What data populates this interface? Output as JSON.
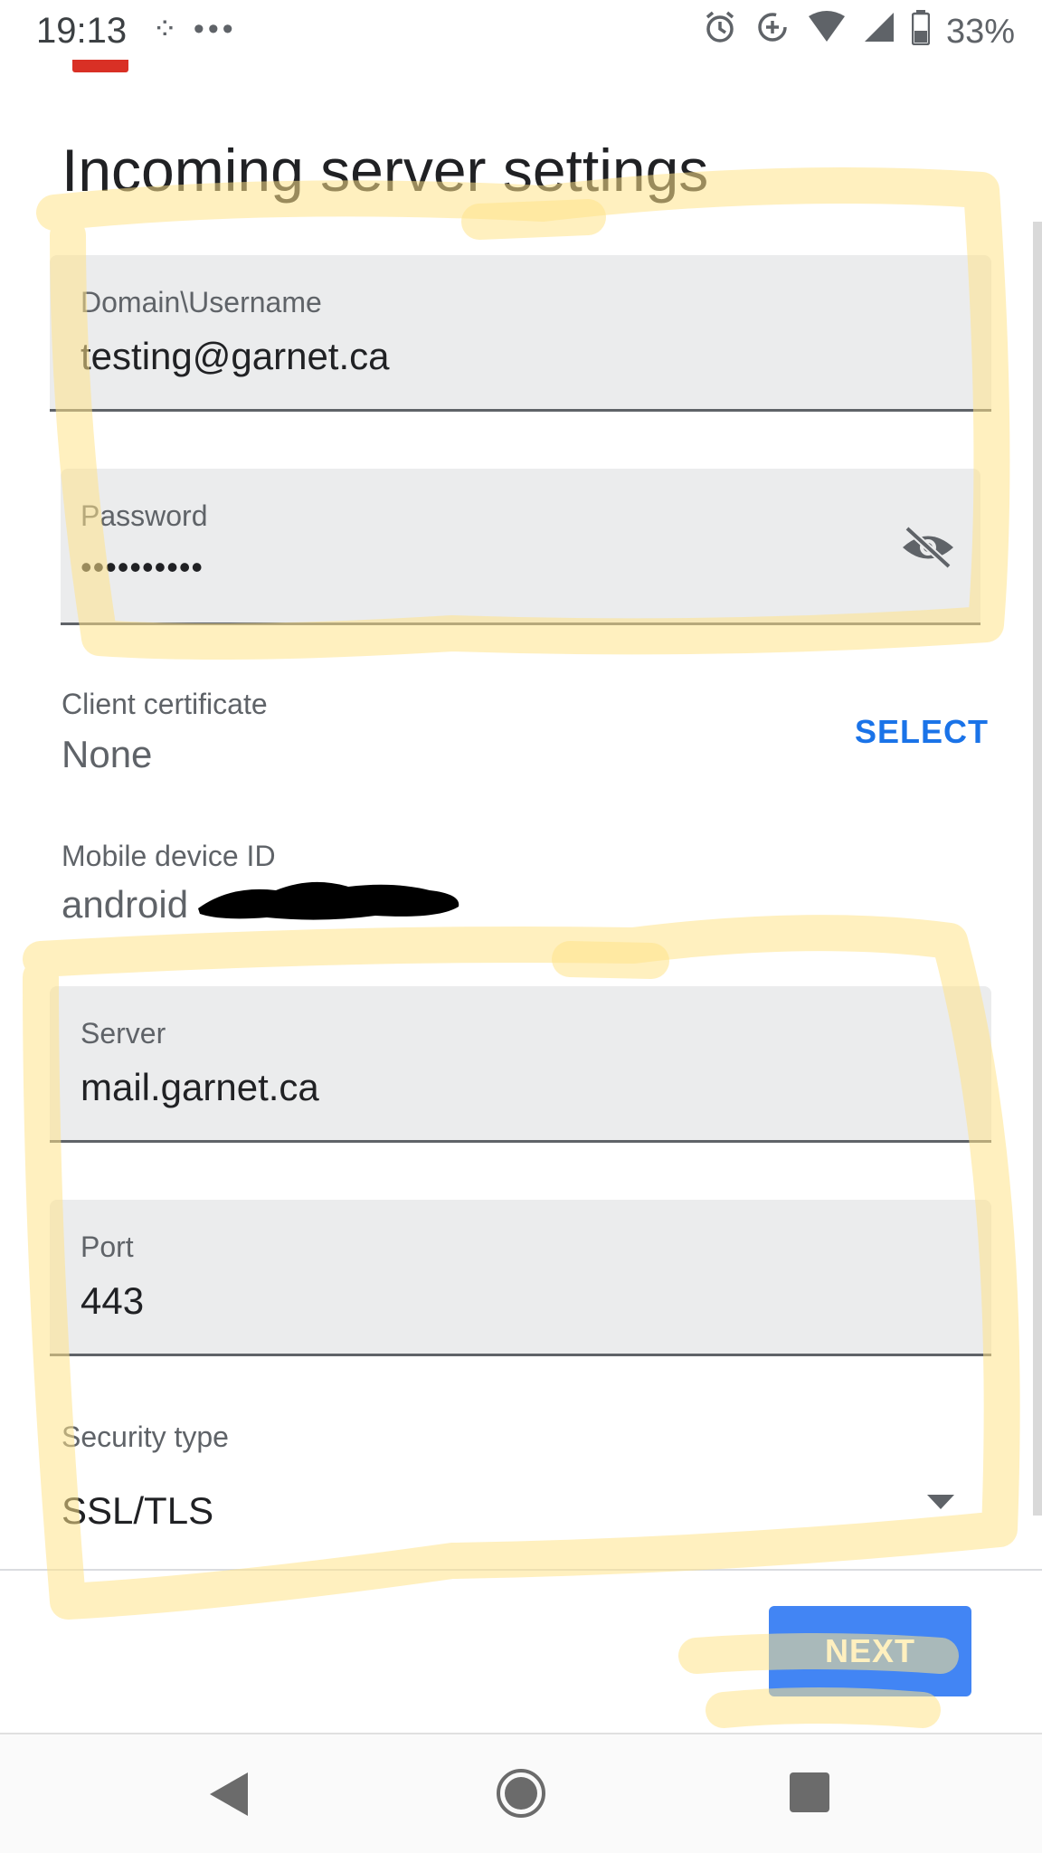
{
  "status_bar": {
    "time": "19:13",
    "left_icons": "⁘ •••",
    "battery": "33%",
    "icons": [
      "alarm-icon",
      "data-saver-icon",
      "wifi-icon",
      "signal-icon",
      "battery-icon"
    ]
  },
  "page": {
    "title": "Incoming server settings"
  },
  "fields": {
    "username": {
      "label": "Domain\\Username",
      "value": "testing@garnet.ca"
    },
    "password": {
      "label": "Password",
      "value": "••••••••••"
    },
    "server": {
      "label": "Server",
      "value": "mail.garnet.ca"
    },
    "port": {
      "label": "Port",
      "value": "443"
    }
  },
  "client_certificate": {
    "label": "Client certificate",
    "value": "None",
    "action": "SELECT"
  },
  "mobile_device_id": {
    "label": "Mobile device ID",
    "value": "android"
  },
  "security_type": {
    "label": "Security type",
    "value": "SSL/TLS"
  },
  "buttons": {
    "next": "NEXT"
  },
  "colors": {
    "accent": "#1a73e8",
    "button": "#4285f4",
    "highlight": "#ffe38a"
  }
}
